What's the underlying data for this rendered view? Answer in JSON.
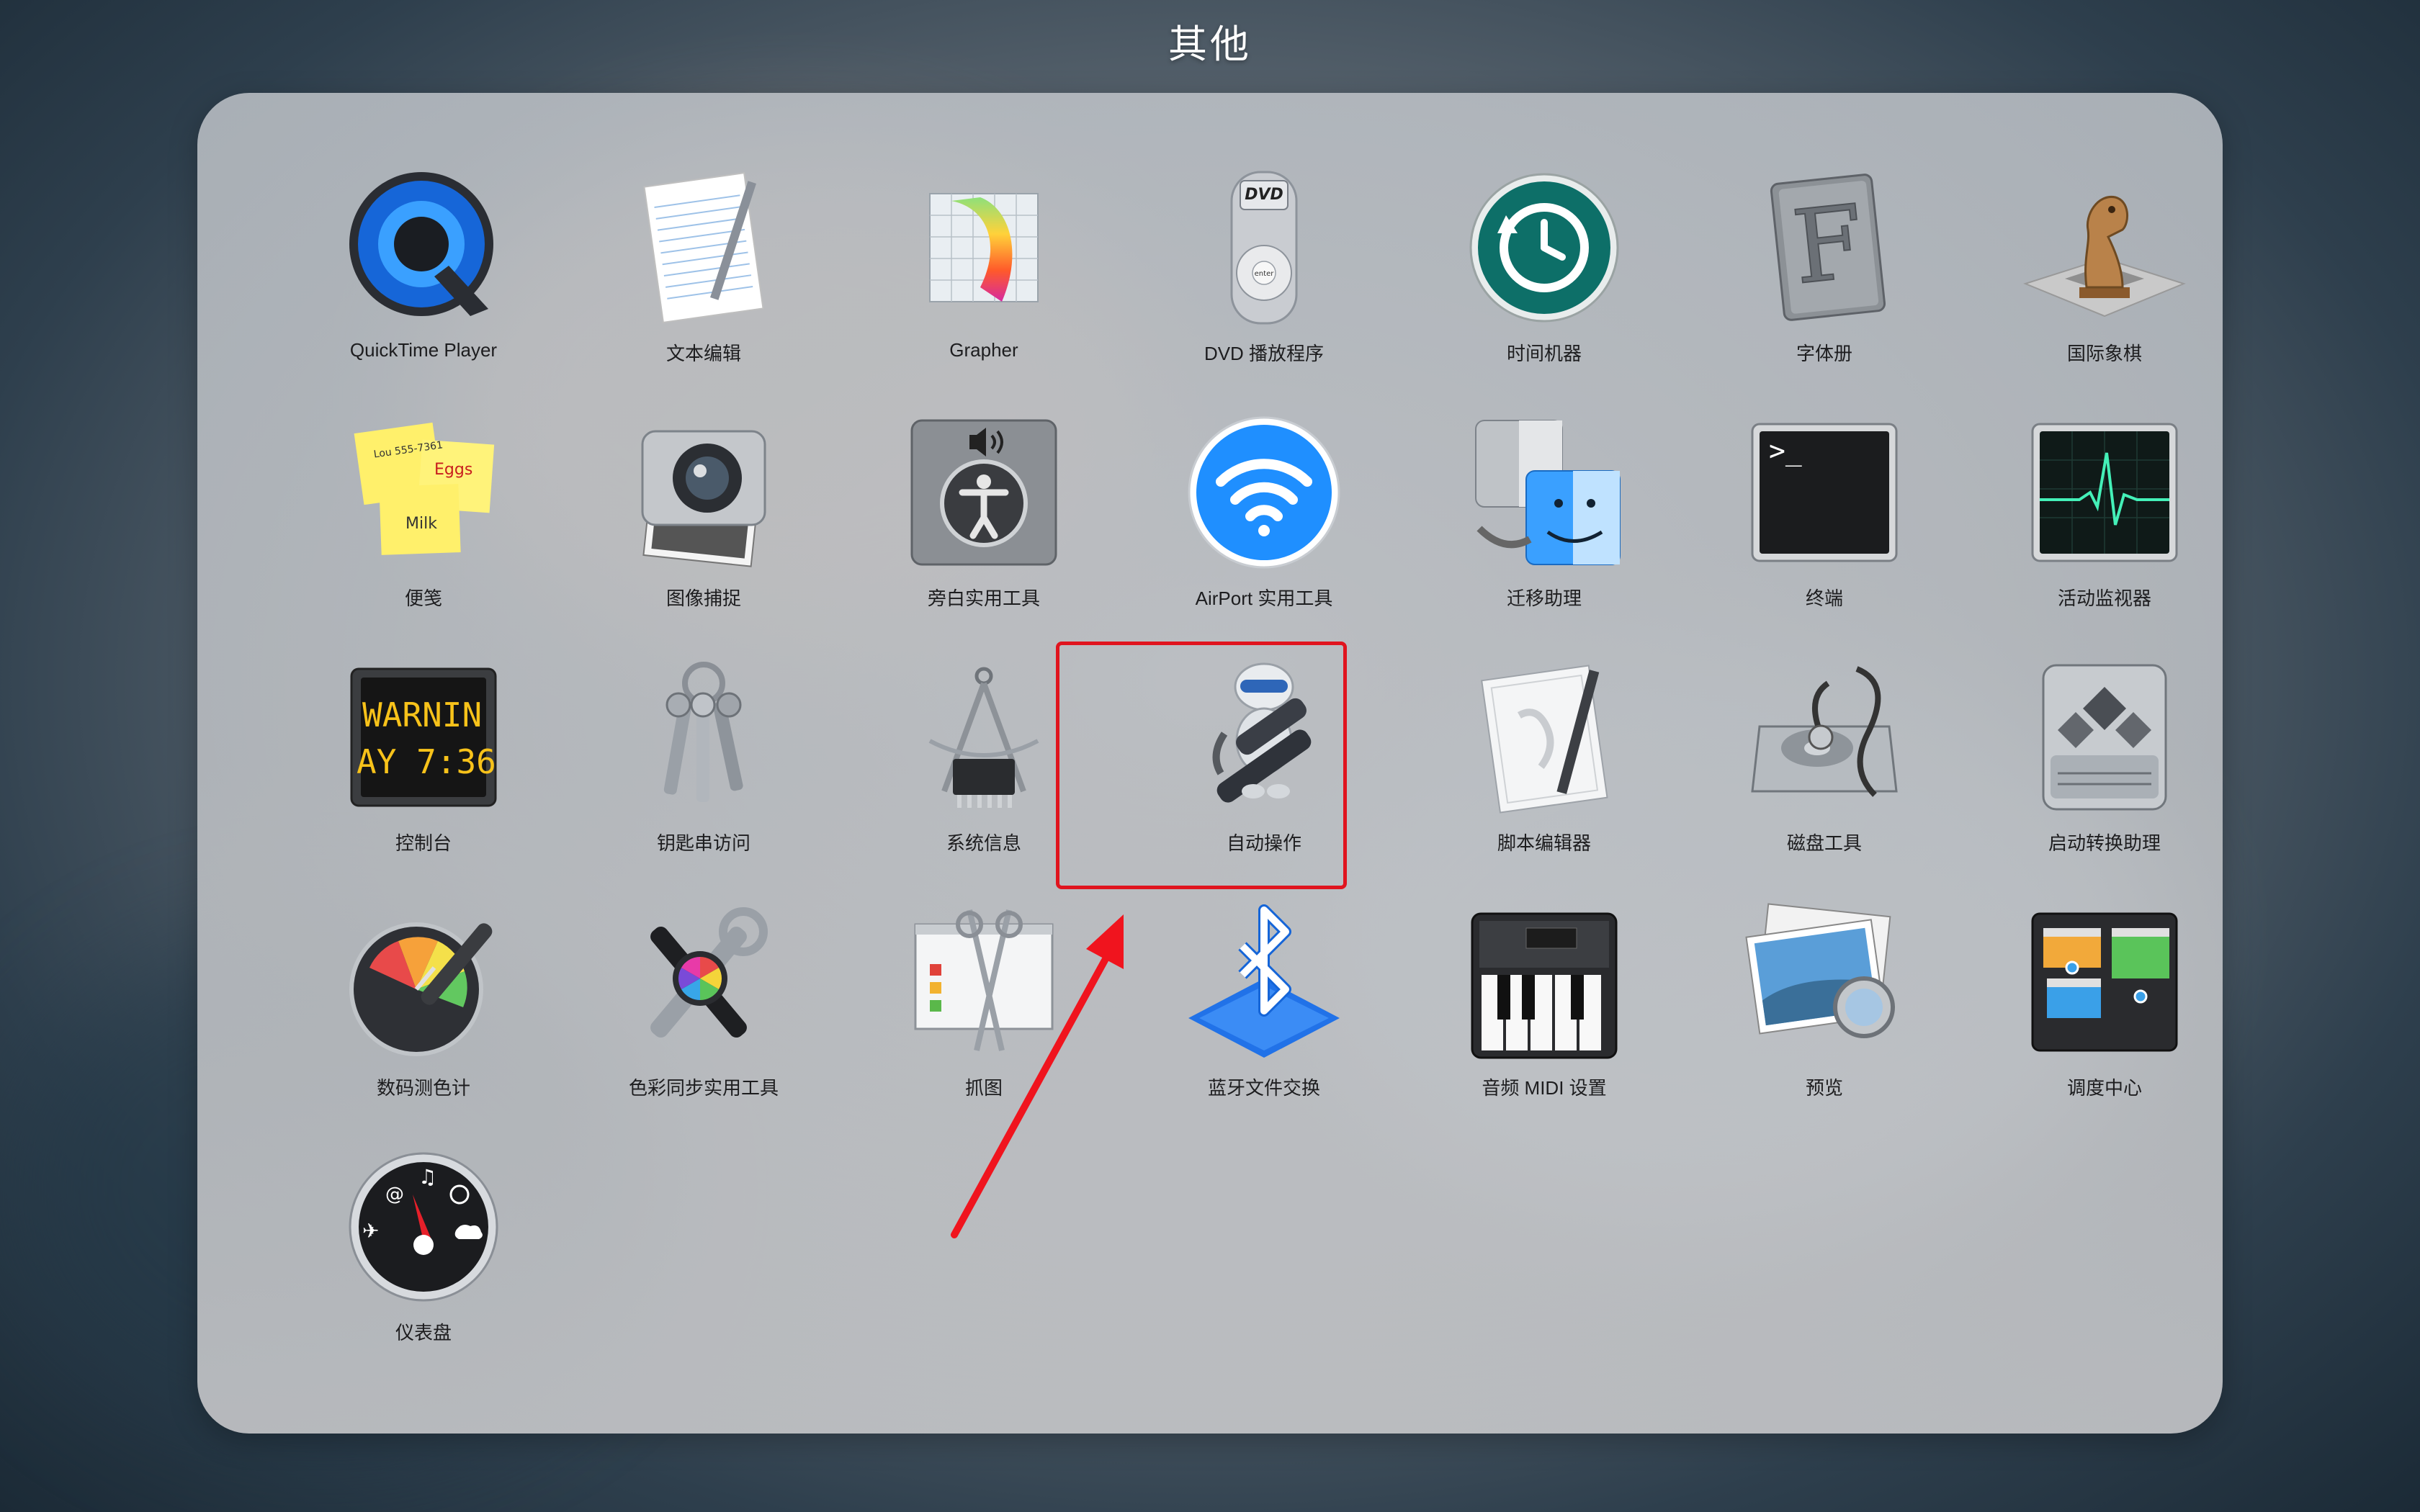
{
  "folder": {
    "title": "其他"
  },
  "apps": [
    {
      "label": "QuickTime Player",
      "icon": "quicktime-icon"
    },
    {
      "label": "文本编辑",
      "icon": "textedit-icon"
    },
    {
      "label": "Grapher",
      "icon": "grapher-icon"
    },
    {
      "label": "DVD 播放程序",
      "icon": "dvd-player-icon"
    },
    {
      "label": "时间机器",
      "icon": "time-machine-icon"
    },
    {
      "label": "字体册",
      "icon": "font-book-icon"
    },
    {
      "label": "国际象棋",
      "icon": "chess-icon"
    },
    {
      "label": "便笺",
      "icon": "stickies-icon"
    },
    {
      "label": "图像捕捉",
      "icon": "image-capture-icon"
    },
    {
      "label": "旁白实用工具",
      "icon": "voiceover-utility-icon"
    },
    {
      "label": "AirPort 实用工具",
      "icon": "airport-utility-icon"
    },
    {
      "label": "迁移助理",
      "icon": "migration-assistant-icon"
    },
    {
      "label": "终端",
      "icon": "terminal-icon"
    },
    {
      "label": "活动监视器",
      "icon": "activity-monitor-icon"
    },
    {
      "label": "控制台",
      "icon": "console-icon"
    },
    {
      "label": "钥匙串访问",
      "icon": "keychain-access-icon"
    },
    {
      "label": "系统信息",
      "icon": "system-information-icon"
    },
    {
      "label": "自动操作",
      "icon": "automator-icon"
    },
    {
      "label": "脚本编辑器",
      "icon": "script-editor-icon"
    },
    {
      "label": "磁盘工具",
      "icon": "disk-utility-icon"
    },
    {
      "label": "启动转换助理",
      "icon": "boot-camp-assistant-icon"
    },
    {
      "label": "数码测色计",
      "icon": "digital-color-meter-icon"
    },
    {
      "label": "色彩同步实用工具",
      "icon": "colorsync-utility-icon"
    },
    {
      "label": "抓图",
      "icon": "grab-icon"
    },
    {
      "label": "蓝牙文件交换",
      "icon": "bluetooth-file-exchange-icon"
    },
    {
      "label": "音频 MIDI 设置",
      "icon": "audio-midi-setup-icon"
    },
    {
      "label": "预览",
      "icon": "preview-icon"
    },
    {
      "label": "调度中心",
      "icon": "mission-control-icon"
    },
    {
      "label": "仪表盘",
      "icon": "dashboard-icon"
    }
  ],
  "console_icon_text": {
    "line1": "WARNIN",
    "line2": "AY 7:36"
  },
  "stickies_icon_text": {
    "note1": "Lou 555-7361",
    "note2": "Eggs",
    "note3": "Milk"
  },
  "dvd_icon_text": {
    "logo": "DVD",
    "button": "enter"
  },
  "terminal_icon_text": {
    "prompt": ">_"
  },
  "annotation": {
    "highlight_color": "#e0141e",
    "highlighted_app": "自动操作"
  }
}
